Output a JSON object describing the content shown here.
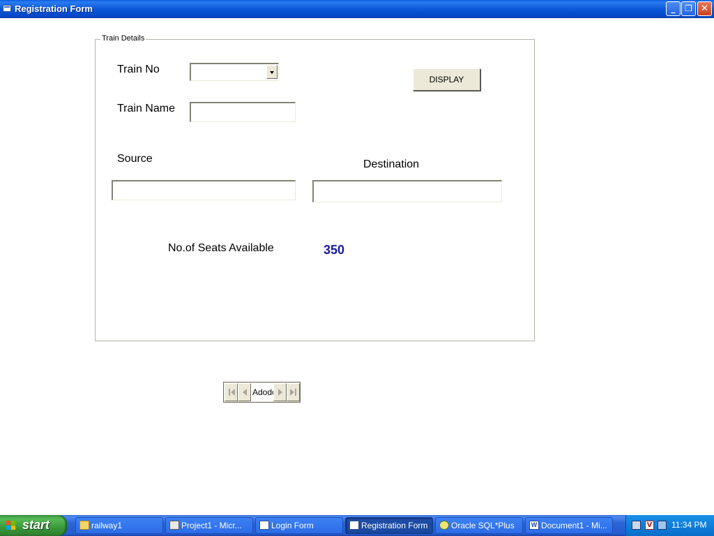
{
  "window": {
    "title": "Registration Form",
    "controls": {
      "minimize": "_",
      "maximize": "❐",
      "close": "✕"
    }
  },
  "frame": {
    "caption": "Train Details"
  },
  "form": {
    "train_no_label": "Train No",
    "train_no_value": "",
    "train_name_label": "Train Name",
    "train_name_value": "",
    "source_label": "Source",
    "source_value": "",
    "destination_label": "Destination",
    "destination_value": "",
    "display_button": "DISPLAY",
    "seats_label": "No.of Seats Available",
    "seats_value": "350"
  },
  "adodc": {
    "caption": "Adodc"
  },
  "taskbar": {
    "start_label": "start",
    "tasks": [
      {
        "label": "railway1",
        "icon": "folder-icon"
      },
      {
        "label": "Project1 - Micr...",
        "icon": "vb-project-icon"
      },
      {
        "label": "Login Form",
        "icon": "form-icon"
      },
      {
        "label": "Registration Form",
        "icon": "form-icon",
        "active": true
      },
      {
        "label": "Oracle SQL*Plus",
        "icon": "oracle-icon"
      },
      {
        "label": "Document1 - Mi...",
        "icon": "word-icon"
      }
    ],
    "clock": "11:34 PM"
  },
  "colors": {
    "title_bar": "#0a58d8",
    "seats_value": "#1a1aa0",
    "taskbar": "#245dd0",
    "start_button": "#3a983a"
  }
}
